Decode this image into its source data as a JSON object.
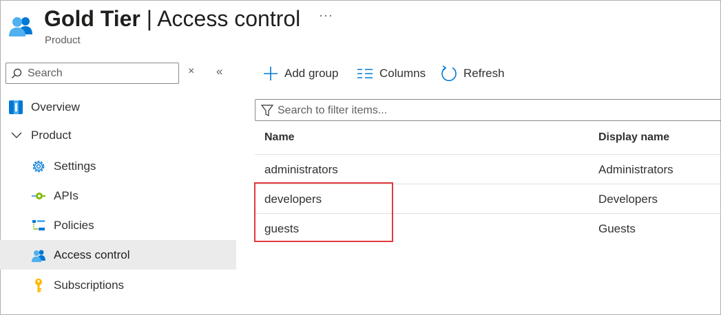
{
  "header": {
    "title_bold": "Gold Tier",
    "title_sep": " | ",
    "title_rest": "Access control",
    "more_label": "···",
    "subtitle": "Product",
    "icon": "users-group-icon"
  },
  "sidebar": {
    "search": {
      "placeholder": "Search",
      "value": ""
    },
    "close_label": "×",
    "collapse_label": "«",
    "items": [
      {
        "label": "Overview",
        "icon": "overview-icon"
      },
      {
        "label": "Product",
        "icon": "chevron-down-icon"
      },
      {
        "label": "Settings",
        "icon": "gear-icon"
      },
      {
        "label": "APIs",
        "icon": "api-icon"
      },
      {
        "label": "Policies",
        "icon": "policies-icon"
      },
      {
        "label": "Access control",
        "icon": "users-group-icon",
        "active": true
      },
      {
        "label": "Subscriptions",
        "icon": "key-icon"
      }
    ]
  },
  "toolbar": {
    "add_group_label": "Add group",
    "columns_label": "Columns",
    "refresh_label": "Refresh"
  },
  "filter": {
    "placeholder": "Search to filter items...",
    "value": ""
  },
  "table": {
    "columns": [
      "Name",
      "Display name"
    ],
    "rows": [
      {
        "name": "administrators",
        "display_name": "Administrators"
      },
      {
        "name": "developers",
        "display_name": "Developers"
      },
      {
        "name": "guests",
        "display_name": "Guests"
      }
    ]
  },
  "colors": {
    "accent": "#0078d4",
    "highlight": "#e0393e",
    "active_bg": "#ebebeb"
  }
}
